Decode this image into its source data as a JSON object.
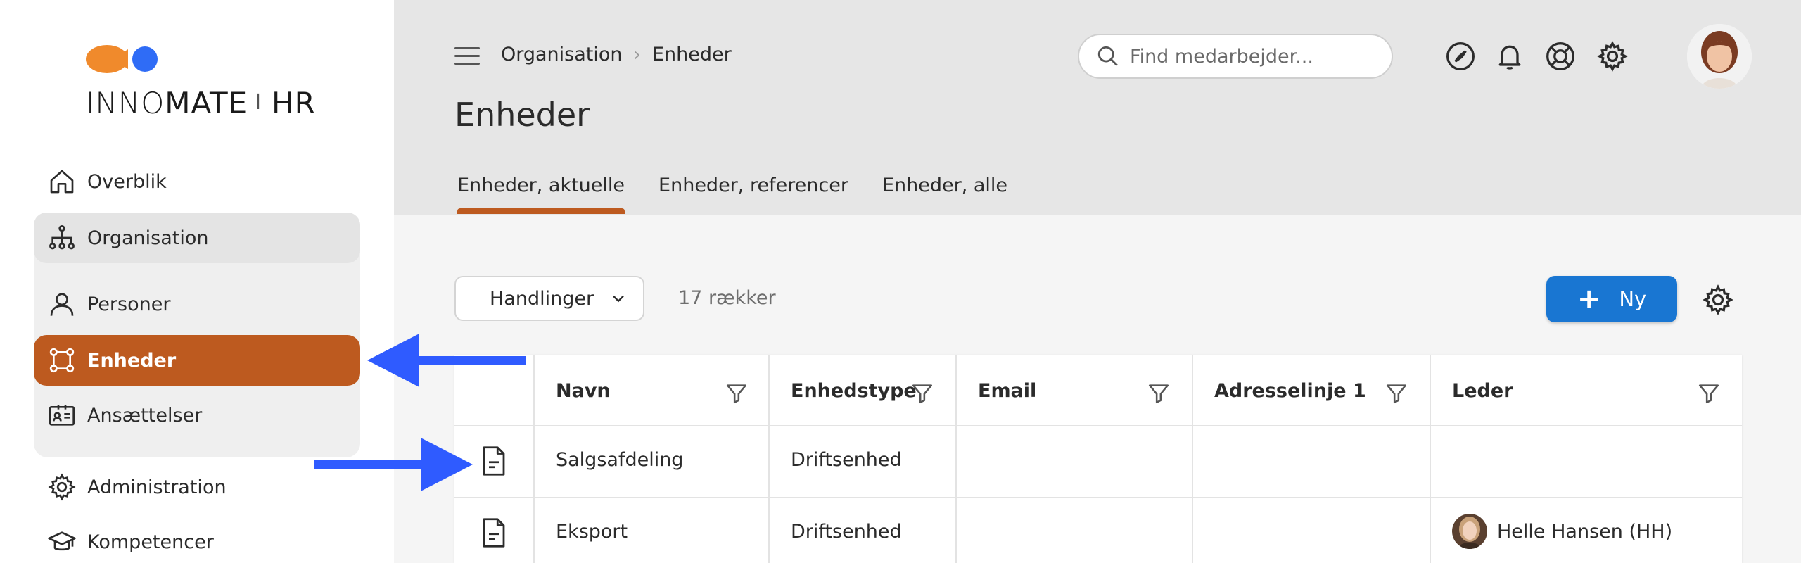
{
  "app": {
    "logo_text_thin": "INNO",
    "logo_text_bold": "MATE",
    "logo_separator": "I",
    "logo_suffix": "HR",
    "brand_color": "#bd5a1f",
    "logo_color_orange": "#f08a2c",
    "logo_color_blue": "#2f6cf6"
  },
  "sidebar": {
    "items": [
      {
        "label": "Overblik",
        "icon": "home-icon"
      },
      {
        "label": "Organisation",
        "icon": "org-chart-icon"
      },
      {
        "label": "Personer",
        "icon": "person-icon"
      },
      {
        "label": "Enheder",
        "icon": "units-icon",
        "active": true
      },
      {
        "label": "Ansættelser",
        "icon": "id-card-icon"
      },
      {
        "label": "Administration",
        "icon": "admin-gear-icon"
      },
      {
        "label": "Kompetencer",
        "icon": "graduation-cap-icon"
      }
    ]
  },
  "header": {
    "breadcrumb": [
      "Organisation",
      "Enheder"
    ],
    "title": "Enheder",
    "search_placeholder": "Find medarbejder...",
    "icons": [
      "navigation-icon",
      "bell-icon",
      "help-lifebuoy-icon",
      "settings-gear-icon"
    ]
  },
  "tabs": [
    {
      "label": "Enheder, aktuelle",
      "active": true
    },
    {
      "label": "Enheder, referencer"
    },
    {
      "label": "Enheder, alle"
    }
  ],
  "toolbar": {
    "actions_label": "Handlinger",
    "row_count": "17 rækker",
    "new_label": "Ny",
    "new_color": "#1976d2"
  },
  "table": {
    "columns": [
      "Navn",
      "Enhedstype",
      "Email",
      "Adresselinje 1",
      "Leder"
    ],
    "rows": [
      {
        "navn": "Salgsafdeling",
        "enhedstype": "Driftsenhed",
        "email": "",
        "adresse": "",
        "leder": ""
      },
      {
        "navn": "Eksport",
        "enhedstype": "Driftsenhed",
        "email": "",
        "adresse": "",
        "leder": "Helle Hansen (HH)"
      }
    ]
  },
  "annotations": {
    "arrow_color": "#2f5bff"
  }
}
